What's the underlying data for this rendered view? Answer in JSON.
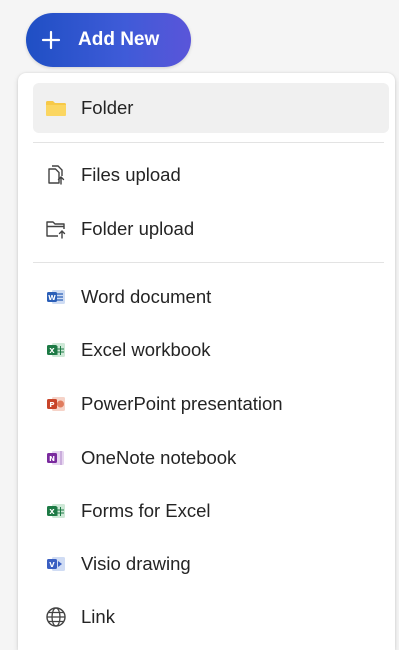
{
  "add_new": {
    "label": "Add New"
  },
  "menu": {
    "items": [
      {
        "label": "Folder",
        "icon": "folder-icon"
      },
      {
        "label": "Files upload",
        "icon": "files-upload-icon"
      },
      {
        "label": "Folder upload",
        "icon": "folder-upload-icon"
      },
      {
        "label": "Word document",
        "icon": "word-icon"
      },
      {
        "label": "Excel workbook",
        "icon": "excel-icon"
      },
      {
        "label": "PowerPoint presentation",
        "icon": "powerpoint-icon"
      },
      {
        "label": "OneNote notebook",
        "icon": "onenote-icon"
      },
      {
        "label": "Forms for Excel",
        "icon": "forms-excel-icon"
      },
      {
        "label": "Visio drawing",
        "icon": "visio-icon"
      },
      {
        "label": "Link",
        "icon": "globe-icon"
      }
    ]
  },
  "colors": {
    "button_start": "#1f4fc4",
    "button_end": "#5a55d9",
    "folder": "#f7c948",
    "word": "#2b5fb8",
    "excel": "#1d7a45",
    "powerpoint": "#c8452a",
    "onenote": "#7a2a9e",
    "visio": "#3a5fc2"
  }
}
